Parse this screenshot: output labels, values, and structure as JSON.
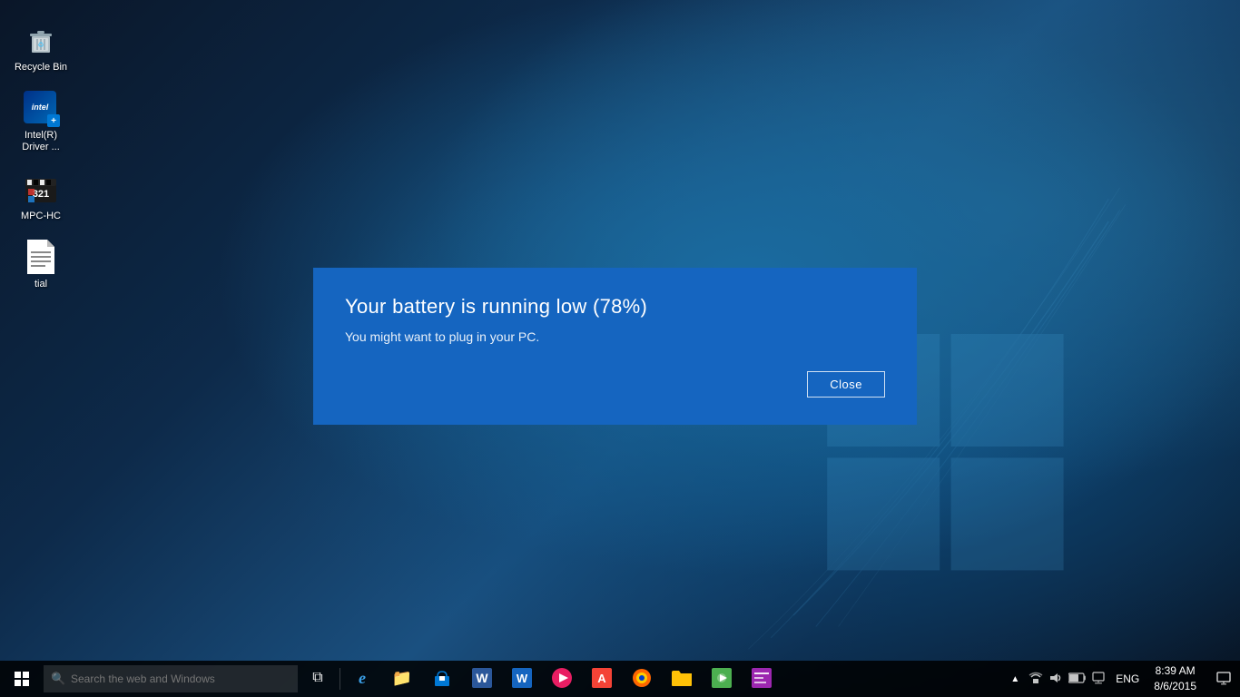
{
  "desktop": {
    "background_desc": "Windows 10 blue desktop background"
  },
  "icons": [
    {
      "id": "recycle-bin",
      "label": "Recycle Bin",
      "icon_type": "recycle"
    },
    {
      "id": "intel-driver",
      "label": "Intel(R)\nDriver ...",
      "label_line1": "Intel(R)",
      "label_line2": "Driver ...",
      "icon_type": "intel"
    },
    {
      "id": "mpc-hc",
      "label": "MPC-HC",
      "icon_type": "mpc"
    },
    {
      "id": "tial",
      "label": "tial",
      "icon_type": "text-file"
    }
  ],
  "notification": {
    "title": "Your battery is running low (78%)",
    "body": "You might want to plug in your PC.",
    "close_label": "Close"
  },
  "taskbar": {
    "search_placeholder": "Search the web and Windows",
    "apps": [
      {
        "id": "task-view",
        "icon": "⧉",
        "label": "Task View"
      },
      {
        "id": "edge",
        "icon": "e",
        "label": "Microsoft Edge"
      },
      {
        "id": "file-explorer",
        "icon": "🗂",
        "label": "File Explorer"
      },
      {
        "id": "store",
        "icon": "🛍",
        "label": "Microsoft Store"
      },
      {
        "id": "word",
        "icon": "W",
        "label": "Word"
      },
      {
        "id": "word2",
        "icon": "W",
        "label": "WordPad"
      },
      {
        "id": "music",
        "icon": "🎵",
        "label": "Music"
      },
      {
        "id": "pdf",
        "icon": "A",
        "label": "Adobe Reader"
      },
      {
        "id": "firefox",
        "icon": "🦊",
        "label": "Firefox"
      },
      {
        "id": "folder2",
        "icon": "📁",
        "label": "Folder"
      },
      {
        "id": "media",
        "icon": "🎬",
        "label": "Media"
      },
      {
        "id": "news",
        "icon": "📰",
        "label": "News"
      }
    ],
    "tray": {
      "language": "ENG",
      "time": "8:39 AM",
      "date": "8/6/2015"
    }
  }
}
